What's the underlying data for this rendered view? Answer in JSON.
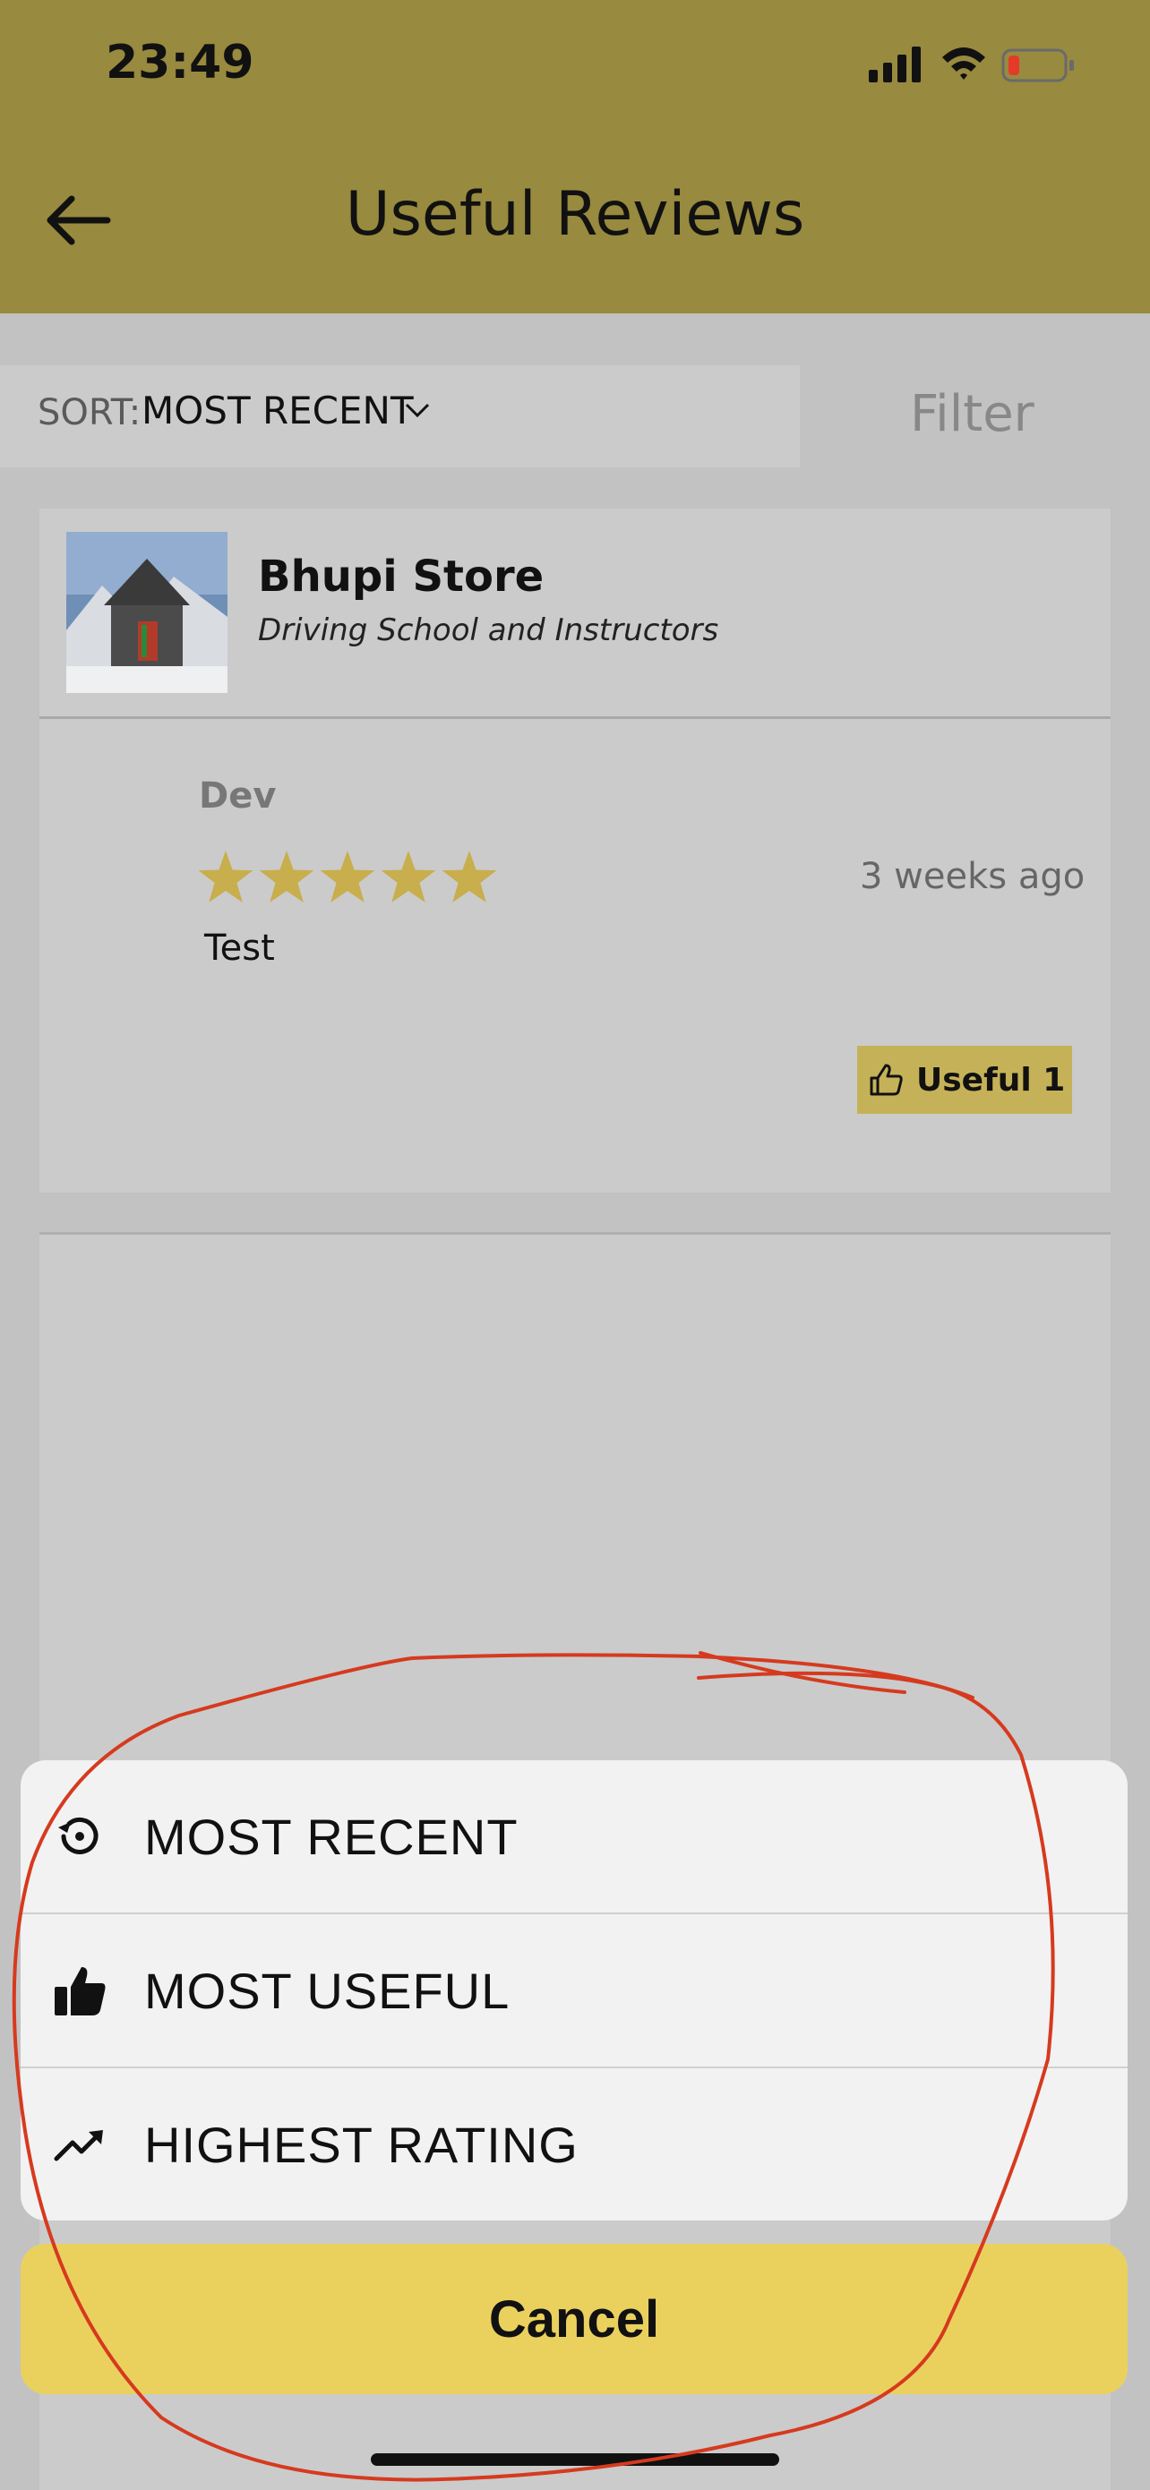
{
  "status_bar": {
    "time": "23:49",
    "icons": [
      "signal-icon",
      "wifi-icon",
      "battery-low-icon"
    ]
  },
  "header": {
    "title": "Useful Reviews",
    "back_icon": "arrow-left-icon"
  },
  "sort_bar": {
    "label": "SORT:",
    "value": "MOST RECENT",
    "chevron_icon": "chevron-down-icon",
    "filter_label": "Filter"
  },
  "business": {
    "name": "Bhupi Store",
    "category": "Driving School and Instructors",
    "thumbnail": "temple-photo"
  },
  "review": {
    "author": "Dev",
    "rating": 5,
    "max_rating": 5,
    "time_ago": "3 weeks ago",
    "text": "Test",
    "useful_label": "Useful 1"
  },
  "action_sheet": {
    "options": [
      {
        "label": "MOST RECENT",
        "icon": "history-icon"
      },
      {
        "label": "MOST USEFUL",
        "icon": "thumbs-up-icon"
      },
      {
        "label": "HIGHEST RATING",
        "icon": "trending-up-icon"
      }
    ],
    "cancel_label": "Cancel"
  },
  "colors": {
    "header": "#988a3e",
    "cancel": "#ead15e",
    "star": "#c8ae4c",
    "annotation": "#d63a1e"
  }
}
